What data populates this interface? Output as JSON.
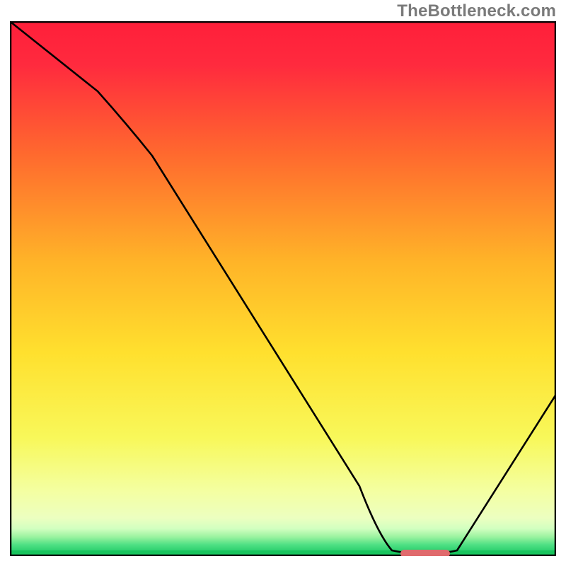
{
  "watermark": {
    "text": "TheBottleneck.com"
  },
  "colors": {
    "border": "#000000",
    "curve": "#000000",
    "watermark": "#7a7a7a",
    "good_gradient_top": "#ff1f3a",
    "good_gradient_mid": "#ffd500",
    "good_gradient_low": "#f8ffb0",
    "ground_band": "#2cdc72",
    "ground_band_deep": "#17c45c",
    "marker": "#e06a6d"
  },
  "chart_data": {
    "type": "line",
    "title": "",
    "xlabel": "",
    "ylabel": "",
    "xlim": [
      0,
      100
    ],
    "ylim": [
      0,
      100
    ],
    "series": [
      {
        "name": "bottleneck-curve",
        "x": [
          0,
          16,
          26,
          64,
          70,
          76,
          82,
          100
        ],
        "y": [
          100,
          87,
          75,
          13,
          1,
          0.6,
          1,
          30
        ]
      }
    ],
    "annotations": [
      {
        "name": "optimal-marker",
        "x_start": 72,
        "x_end": 80,
        "y": 0.6
      }
    ],
    "background": {
      "type": "vertical-gradient",
      "description": "red (high y) → orange → yellow → pale-yellow → green band at y≈0"
    }
  }
}
